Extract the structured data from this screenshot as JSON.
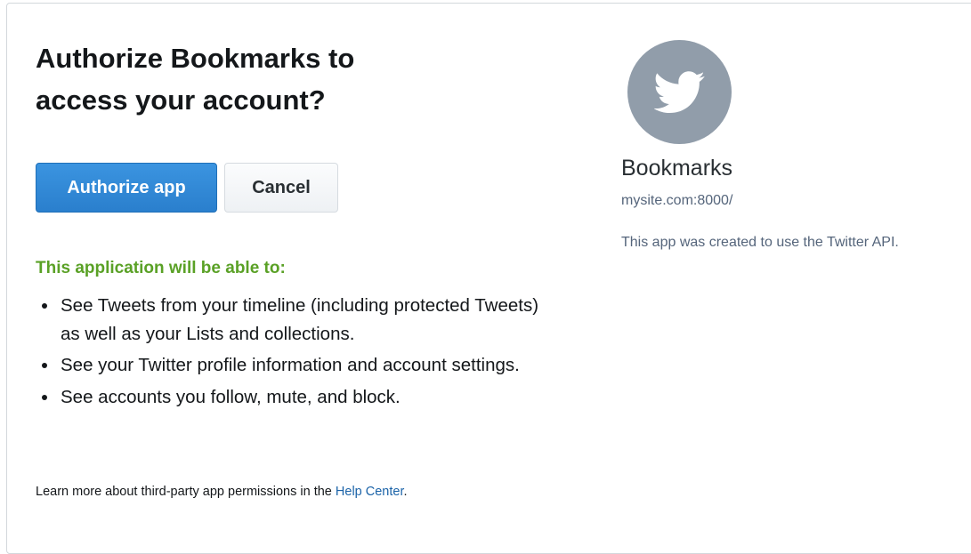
{
  "auth": {
    "title": "Authorize Bookmarks to access your account?",
    "authorize_label": "Authorize app",
    "cancel_label": "Cancel",
    "permissions_heading": "This application will be able to:",
    "permissions": [
      "See Tweets from your timeline (including protected Tweets) as well as your Lists and collections.",
      "See your Twitter profile information and account settings.",
      "See accounts you follow, mute, and block."
    ],
    "help_text": "Learn more about third-party app permissions in the ",
    "help_link": "Help Center",
    "help_suffix": "."
  },
  "app": {
    "avatar_icon": "twitter-bird-icon",
    "name": "Bookmarks",
    "url": "mysite.com:8000/",
    "description": "This app was created to use the Twitter API."
  },
  "colors": {
    "primary_button": "#2b88d8",
    "permissions_heading": "#5aa126",
    "link": "#1b63a8",
    "avatar_bg": "#919daa",
    "muted_text": "#55657b"
  }
}
